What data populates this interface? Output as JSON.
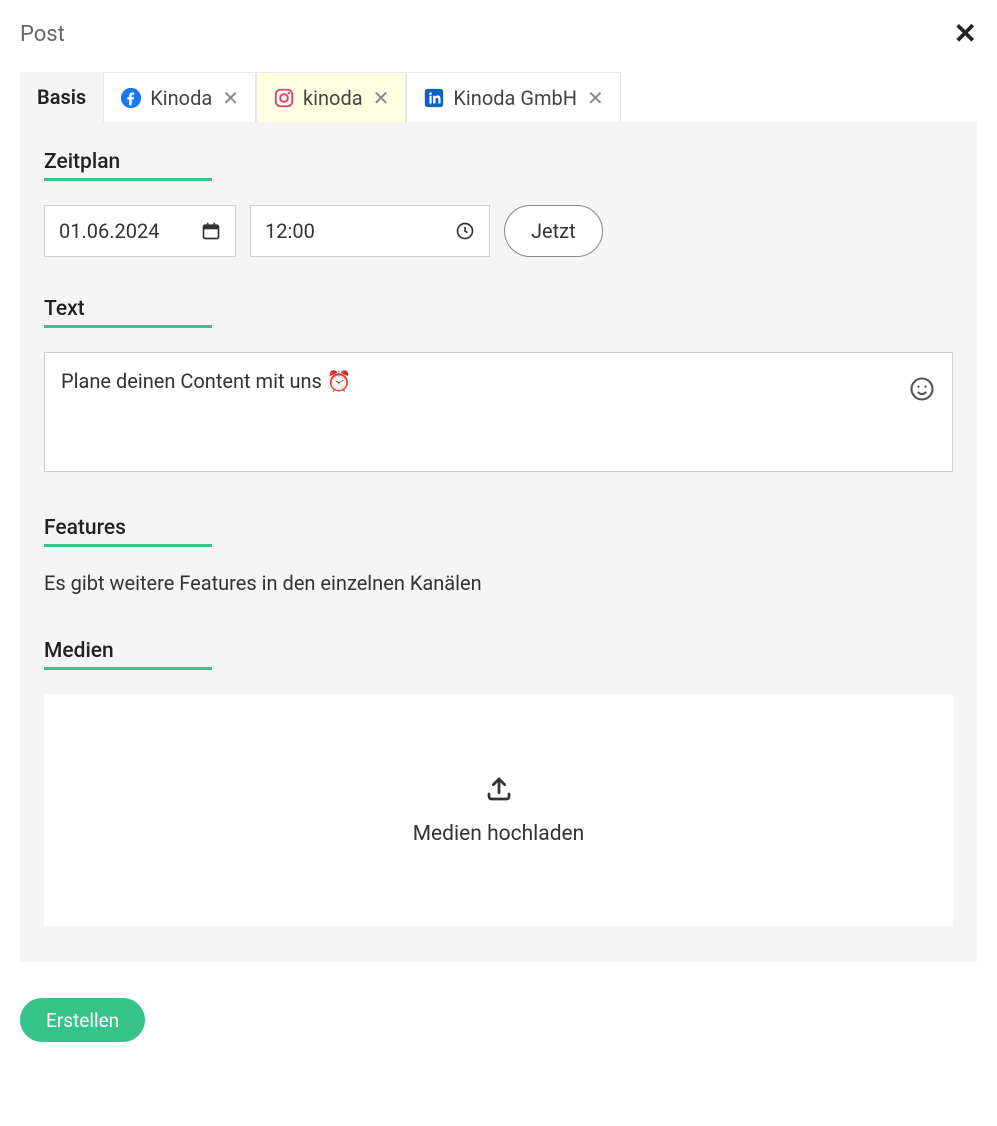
{
  "header": {
    "title": "Post"
  },
  "tabs": {
    "basis": "Basis",
    "channels": [
      {
        "network": "facebook",
        "label": "Kinoda"
      },
      {
        "network": "instagram",
        "label": "kinoda"
      },
      {
        "network": "linkedin",
        "label": "Kinoda GmbH"
      }
    ]
  },
  "sections": {
    "schedule_label": "Zeitplan",
    "text_label": "Text",
    "features_label": "Features",
    "media_label": "Medien"
  },
  "schedule": {
    "date": "01.06.2024",
    "time": "12:00",
    "now_btn": "Jetzt"
  },
  "text": {
    "content": "Plane deinen Content mit uns ⏰"
  },
  "features": {
    "note": "Es gibt weitere Features in den einzelnen Kanälen"
  },
  "media": {
    "upload_label": "Medien hochladen"
  },
  "footer": {
    "create_btn": "Erstellen"
  }
}
